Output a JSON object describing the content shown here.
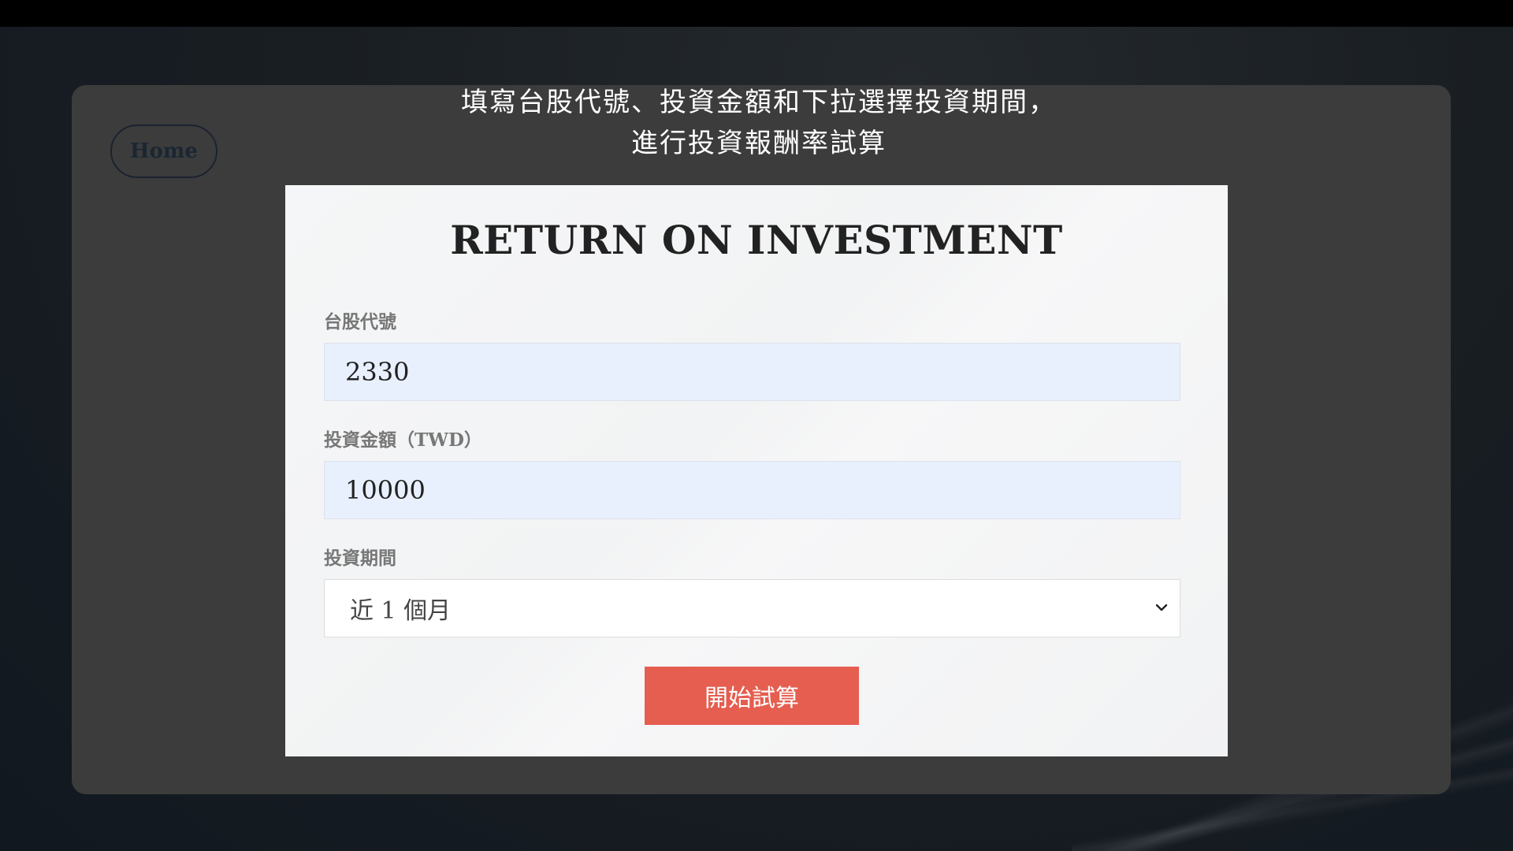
{
  "nav": {
    "home_label": "Home"
  },
  "intro": {
    "line1": "填寫台股代號、投資金額和下拉選擇投資期間，",
    "line2": "進行投資報酬率試算"
  },
  "form": {
    "title": "RETURN ON INVESTMENT",
    "stock_code_label": "台股代號",
    "stock_code_value": "2330",
    "amount_label": "投資金額（TWD）",
    "amount_value": "10000",
    "period_label": "投資期間",
    "period_selected": "近 1 個月",
    "submit_label": "開始試算"
  },
  "colors": {
    "submit_button": "#e55e50",
    "input_autofill_bg": "#e8f0fe",
    "panel_bg": "#3c3c3c"
  }
}
